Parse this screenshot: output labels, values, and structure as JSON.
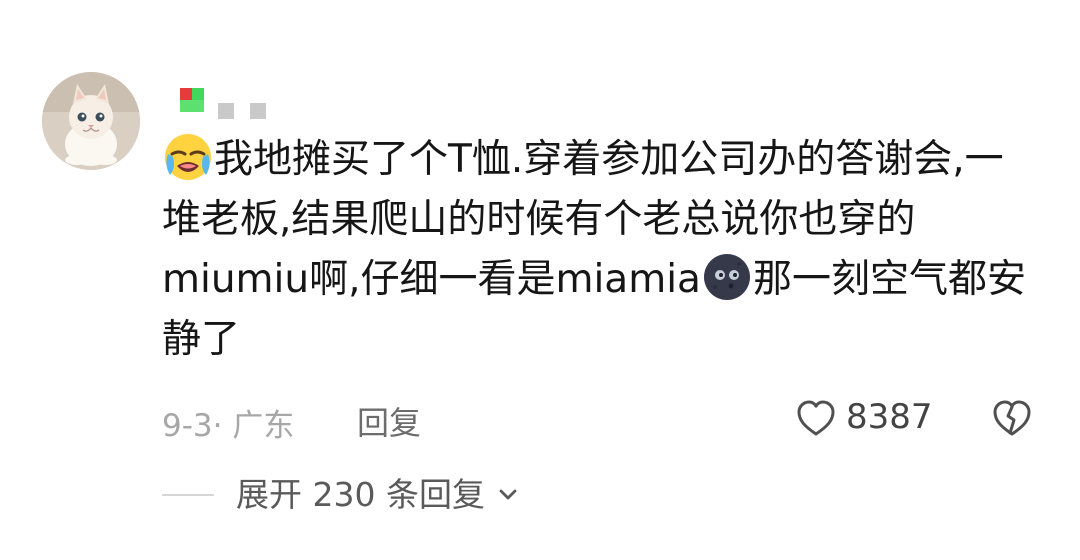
{
  "comment": {
    "line1_text": "我地摊买了个T恤.穿着参加公司办的答谢会,一",
    "line2_text": "堆老板,结果爬山的时候有个老总说你也穿的",
    "line3_before": "miumiu啊,仔细一看是miamia",
    "line3_after": "那一刻空气都安",
    "line4_text": "静了",
    "emoji_start": "crying-face-icon",
    "emoji_middle": "new-moon-face-icon"
  },
  "meta": {
    "date_location": "9-3· 广东",
    "reply_label": "回复",
    "like_count": "8387"
  },
  "expand": {
    "label": "展开 230 条回复"
  },
  "colors": {
    "text": "#161616",
    "meta": "#a7a7a7",
    "reply": "#6c6c6c",
    "icon": "#555555"
  }
}
